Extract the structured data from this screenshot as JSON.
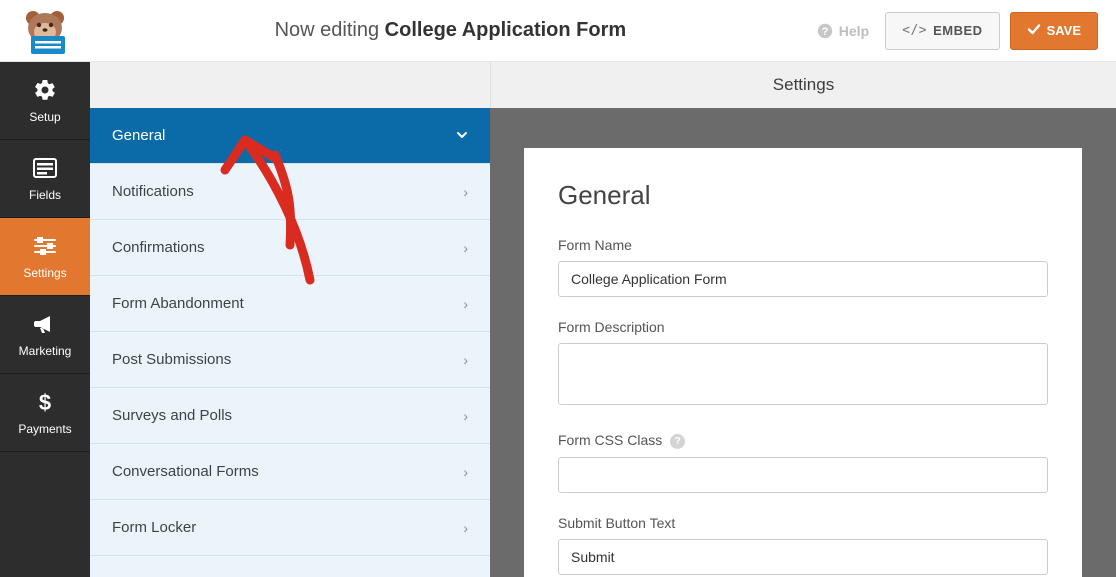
{
  "header": {
    "editing_prefix": "Now editing",
    "form_title": "College Application Form",
    "help_label": "Help",
    "embed_label": "EMBED",
    "save_label": "SAVE"
  },
  "sidebar": {
    "items": [
      {
        "label": "Setup"
      },
      {
        "label": "Fields"
      },
      {
        "label": "Settings"
      },
      {
        "label": "Marketing"
      },
      {
        "label": "Payments"
      }
    ],
    "active_index": 2
  },
  "main_header": "Settings",
  "settings_menu": {
    "items": [
      {
        "label": "General"
      },
      {
        "label": "Notifications"
      },
      {
        "label": "Confirmations"
      },
      {
        "label": "Form Abandonment"
      },
      {
        "label": "Post Submissions"
      },
      {
        "label": "Surveys and Polls"
      },
      {
        "label": "Conversational Forms"
      },
      {
        "label": "Form Locker"
      }
    ],
    "active_index": 0
  },
  "panel": {
    "heading": "General",
    "fields": {
      "form_name": {
        "label": "Form Name",
        "value": "College Application Form"
      },
      "form_description": {
        "label": "Form Description",
        "value": ""
      },
      "form_css_class": {
        "label": "Form CSS Class",
        "value": ""
      },
      "submit_button_text": {
        "label": "Submit Button Text",
        "value": "Submit"
      }
    }
  }
}
